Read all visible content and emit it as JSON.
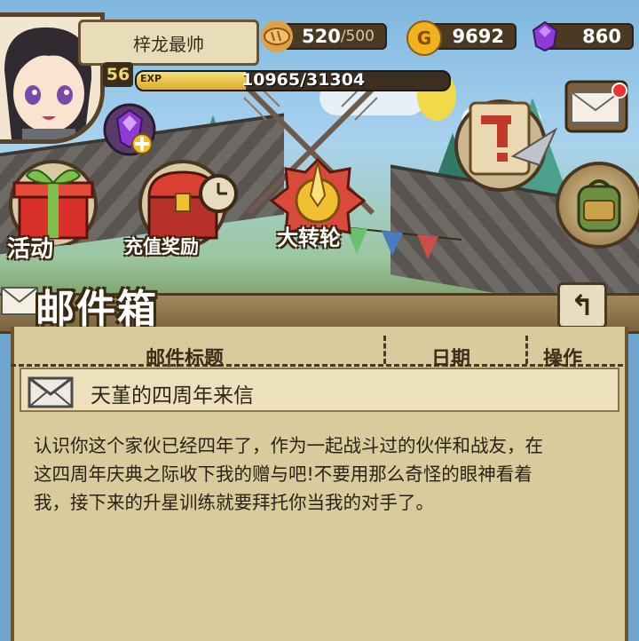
{
  "player": {
    "name": "梓龙最帅",
    "level": "56",
    "exp_tag": "EXP",
    "exp_text": "10965/31304",
    "exp_fraction": 0.35
  },
  "resources": {
    "stamina_current": "520",
    "stamina_max": "/500",
    "gold": "9692",
    "gems": "860"
  },
  "buttons": {
    "activity": "活动",
    "recharge_reward": "充值奖励",
    "big_wheel": "大转轮"
  },
  "icons": {
    "bread": "bread-icon",
    "coin": "coin-icon",
    "gem": "gem-icon",
    "coin_letter": "G"
  },
  "mailbox": {
    "title": "邮件箱",
    "columns": [
      "邮件标题",
      "日期",
      "操作"
    ],
    "subject": "天堇的四周年来信",
    "body_lines": [
      "认识你这个家伙已经四年了，作为一起战斗过的伙伴和战友，在",
      "这四周年庆典之际收下我的赠与吧!不要用那么奇怪的眼神看着",
      "我，接下来的升星训练就要拜托你当我的对手了。"
    ],
    "back_glyph": "↰"
  },
  "colors": {
    "panel": "#d9cb9c",
    "frame": "#5b4328",
    "gem_purple": "#8e3ad6",
    "coin_gold": "#f0b21d"
  }
}
